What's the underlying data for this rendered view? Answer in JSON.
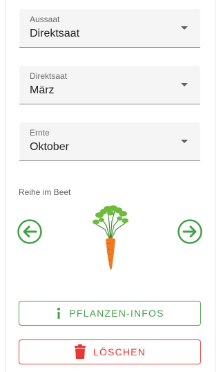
{
  "fields": [
    {
      "label": "Aussaat",
      "value": "Direktsaat"
    },
    {
      "label": "Direktsaat",
      "value": "März"
    },
    {
      "label": "Ernte",
      "value": "Oktober"
    }
  ],
  "row": {
    "label": "Reihe im Beet"
  },
  "buttons": {
    "info_label": "PFLANZEN-INFOS",
    "delete_label": "LÖSCHEN"
  },
  "icons": {
    "prev": "arrow-left-circle-icon",
    "next": "arrow-right-circle-icon",
    "plant": "carrot-icon",
    "info": "info-icon",
    "delete": "trash-icon"
  },
  "colors": {
    "accent_green": "#43a047",
    "danger_red": "#e53935",
    "field_bg": "#f5f5f5"
  }
}
